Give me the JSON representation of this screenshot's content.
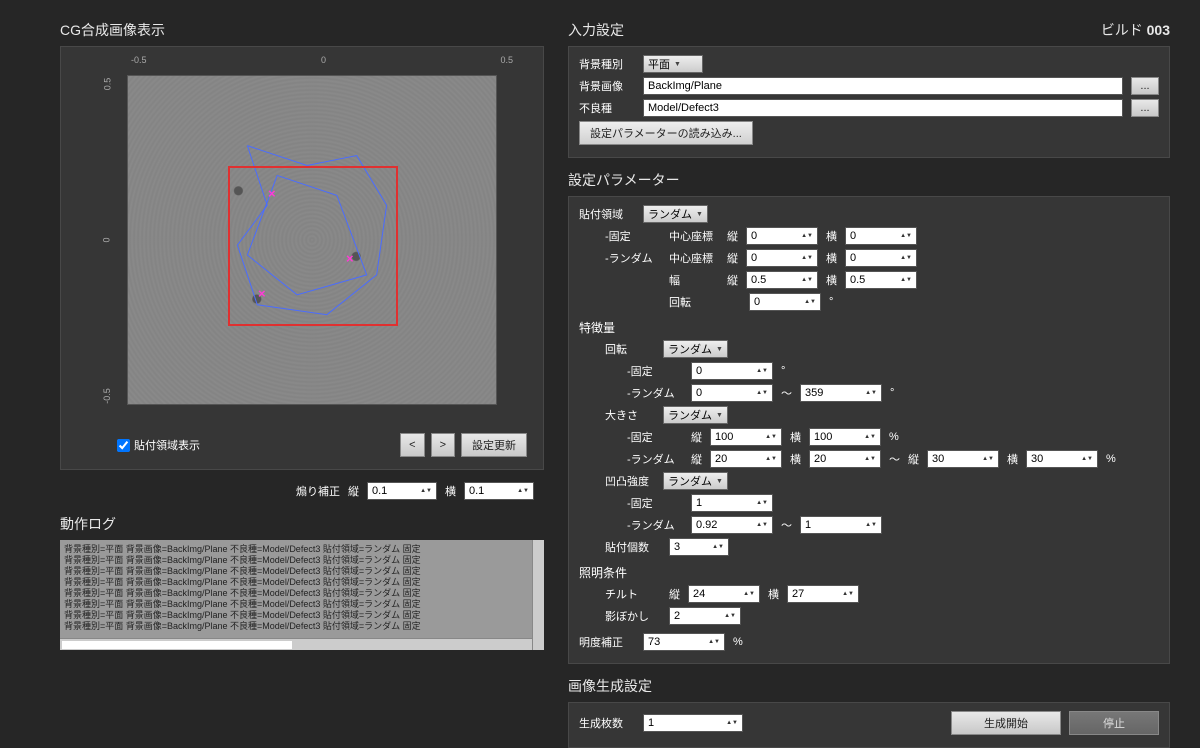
{
  "left": {
    "title": "CG合成画像表示",
    "axis": {
      "ticks": [
        "-0.5",
        "0",
        "0.5"
      ]
    },
    "show_region_chk": "貼付領域表示",
    "prev_btn": "<",
    "next_btn": ">",
    "update_btn": "設定更新",
    "shear_label": "煽り補正",
    "vert_label": "縦",
    "horiz_label": "横",
    "shear_v": "0.1",
    "shear_h": "0.1",
    "log_title": "動作ログ",
    "log_line": "背景種別=平面 背景画像=BackImg/Plane 不良種=Model/Defect3 貼付領域=ランダム 固定"
  },
  "right": {
    "input_title": "入力設定",
    "build_label": "ビルド",
    "build_num": "003",
    "bg_type_label": "背景種別",
    "bg_type_value": "平面",
    "bg_img_label": "背景画像",
    "bg_img_value": "BackImg/Plane",
    "defect_label": "不良種",
    "defect_value": "Model/Defect3",
    "load_params_btn": "設定パラメーターの読み込み...",
    "dots": "...",
    "params_title": "設定パラメーター",
    "paste_region_label": "貼付領域",
    "random_value": "ランダム",
    "fixed_label": "-固定",
    "random_label": "-ランダム",
    "center_label": "中心座標",
    "width_label": "幅",
    "rotation_label": "回転",
    "feature_label": "特徴量",
    "size_label": "大きさ",
    "unevenness_label": "凹凸強度",
    "count_label": "貼付個数",
    "light_label": "照明条件",
    "tilt_label": "チルト",
    "blur_label": "影ぼかし",
    "brightness_label": "明度補正",
    "vert": "縦",
    "horiz": "横",
    "deg": "°",
    "pct": "%",
    "tilde": "～",
    "vals": {
      "zero": "0",
      "half": "0.5",
      "one": "1",
      "two": "2",
      "three": "3",
      "twenty": "20",
      "twentyfour": "24",
      "twentyseven": "27",
      "thirty": "30",
      "seventythree": "73",
      "ninetytwo": "0.92",
      "hundred": "100",
      "threefiftynine": "359"
    },
    "gen_title": "画像生成設定",
    "gen_count_label": "生成枚数",
    "gen_count": "1",
    "start_btn": "生成開始",
    "stop_btn": "停止"
  }
}
